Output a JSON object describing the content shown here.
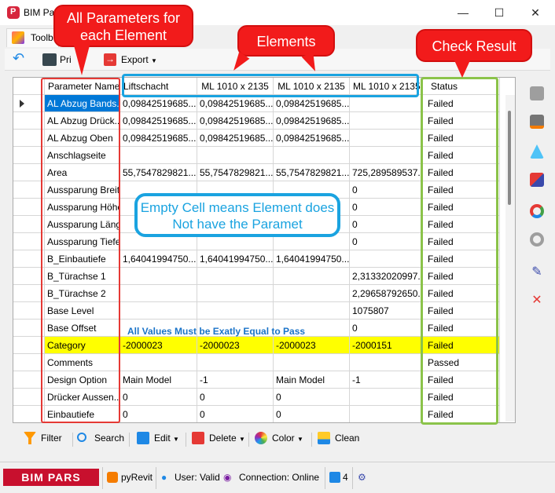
{
  "window": {
    "title": "BIM Pa"
  },
  "menu": {
    "tab": "Toolb"
  },
  "toolbar": {
    "print": "Pri",
    "export": "Export"
  },
  "grid": {
    "columns": [
      "Parameter Name",
      "Liftschacht",
      "ML 1010 x 2135",
      "ML 1010 x 2135",
      "ML 1010 x 2135",
      "Status"
    ],
    "rows": [
      {
        "param": "AL Abzug Bands...",
        "v1": "0,09842519685...",
        "v2": "0,09842519685...",
        "v3": "0,09842519685...",
        "v4": "",
        "status": "Failed"
      },
      {
        "param": "AL Abzug Drück...",
        "v1": "0,09842519685...",
        "v2": "0,09842519685...",
        "v3": "0,09842519685...",
        "v4": "",
        "status": "Failed"
      },
      {
        "param": "AL Abzug Oben",
        "v1": "0,09842519685...",
        "v2": "0,09842519685...",
        "v3": "0,09842519685...",
        "v4": "",
        "status": "Failed"
      },
      {
        "param": "Anschlagseite",
        "v1": "",
        "v2": "",
        "v3": "",
        "v4": "",
        "status": "Failed"
      },
      {
        "param": "Area",
        "v1": "55,7547829821...",
        "v2": "55,7547829821...",
        "v3": "55,7547829821...",
        "v4": "725,289589537...",
        "status": "Failed"
      },
      {
        "param": "Aussparung Breite",
        "v1": "",
        "v2": "",
        "v3": "",
        "v4": "0",
        "status": "Failed"
      },
      {
        "param": "Aussparung Höhe",
        "v1": "",
        "v2": "",
        "v3": "",
        "v4": "0",
        "status": "Failed"
      },
      {
        "param": "Aussparung Länge",
        "v1": "",
        "v2": "",
        "v3": "",
        "v4": "0",
        "status": "Failed"
      },
      {
        "param": "Aussparung Tiefe",
        "v1": "",
        "v2": "",
        "v3": "",
        "v4": "0",
        "status": "Failed"
      },
      {
        "param": "B_Einbautiefe",
        "v1": "1,64041994750...",
        "v2": "1,64041994750...",
        "v3": "1,64041994750...",
        "v4": "",
        "status": "Failed"
      },
      {
        "param": "B_Türachse 1",
        "v1": "",
        "v2": "",
        "v3": "",
        "v4": "2,31332020997...",
        "status": "Failed"
      },
      {
        "param": "B_Türachse 2",
        "v1": "",
        "v2": "",
        "v3": "",
        "v4": "2,29658792650...",
        "status": "Failed"
      },
      {
        "param": "Base Level",
        "v1": "",
        "v2": "",
        "v3": "",
        "v4": "1075807",
        "status": "Failed"
      },
      {
        "param": "Base Offset",
        "v1": "",
        "v2": "",
        "v3": "",
        "v4": "0",
        "status": "Failed"
      },
      {
        "param": "Category",
        "v1": "-2000023",
        "v2": "-2000023",
        "v3": "-2000023",
        "v4": "-2000151",
        "status": "Failed"
      },
      {
        "param": "Comments",
        "v1": "",
        "v2": "",
        "v3": "",
        "v4": "",
        "status": "Passed"
      },
      {
        "param": "Design Option",
        "v1": "Main Model",
        "v2": "-1",
        "v3": "Main Model",
        "v4": "-1",
        "status": "Failed"
      },
      {
        "param": "Drücker Aussen...",
        "v1": "0",
        "v2": "0",
        "v3": "0",
        "v4": "",
        "status": "Failed"
      },
      {
        "param": "Einbautiefe",
        "v1": "0",
        "v2": "0",
        "v3": "0",
        "v4": "",
        "status": "Failed"
      }
    ]
  },
  "commands": {
    "filter": "Filter",
    "search": "Search",
    "edit": "Edit",
    "delete": "Delete",
    "color": "Color",
    "clean": "Clean"
  },
  "status_bar": {
    "brand": "BIM PARS",
    "pyrevit": "pyRevit",
    "user": "User: Valid",
    "connection": "Connection: Online",
    "count": "4"
  },
  "annotations": {
    "params_callout": "All Parameters for each Element",
    "elements_callout": "Elements",
    "check_callout": "Check Result",
    "empty_note": "Empty Cell means Element does Not have the Paramet",
    "equal_note": "All Values Must be Exatly Equal to Pass"
  },
  "colors": {
    "callout_red": "#f21b1b",
    "blue_box": "#1aa3e0",
    "green_box": "#8bc34a",
    "highlight": "#ffff00",
    "selection": "#0078d7",
    "brand_red": "#c8102e"
  }
}
